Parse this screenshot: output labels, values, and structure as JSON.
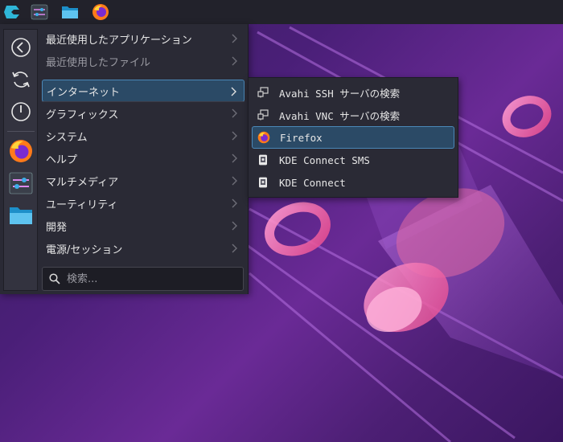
{
  "panel": {
    "launcher_icon": "kde-launcher-icon",
    "system_settings_icon": "system-settings-icon",
    "file_manager_icon": "file-manager-icon",
    "firefox_icon": "firefox-icon"
  },
  "favorites": [
    {
      "icon": "back-arrow-icon"
    },
    {
      "icon": "refresh-icon"
    },
    {
      "icon": "power-icon"
    },
    {
      "icon": "firefox-icon"
    },
    {
      "icon": "system-settings-icon"
    },
    {
      "icon": "file-manager-icon"
    }
  ],
  "categories": [
    {
      "label": "最近使用したアプリケーション",
      "state": "normal"
    },
    {
      "label": "最近使用したファイル",
      "state": "dim"
    },
    {
      "label": "インターネット",
      "state": "active"
    },
    {
      "label": "グラフィックス",
      "state": "normal"
    },
    {
      "label": "システム",
      "state": "normal"
    },
    {
      "label": "ヘルプ",
      "state": "normal"
    },
    {
      "label": "マルチメディア",
      "state": "normal"
    },
    {
      "label": "ユーティリティ",
      "state": "normal"
    },
    {
      "label": "開発",
      "state": "normal"
    },
    {
      "label": "電源/セッション",
      "state": "normal"
    }
  ],
  "search": {
    "placeholder": "検索..."
  },
  "submenu": [
    {
      "label": "Avahi SSH サーバの検索",
      "icon": "network-icon"
    },
    {
      "label": "Avahi VNC サーバの検索",
      "icon": "network-icon"
    },
    {
      "label": "Firefox",
      "icon": "firefox-icon",
      "active": true
    },
    {
      "label": "KDE Connect SMS",
      "icon": "kde-connect-icon"
    },
    {
      "label": "KDE Connect",
      "icon": "kde-connect-icon"
    }
  ],
  "colors": {
    "accent": "#4b88b8",
    "highlight": "#2b4a66",
    "menu_bg": "#2a2a35",
    "panel_bg": "#22222b"
  }
}
